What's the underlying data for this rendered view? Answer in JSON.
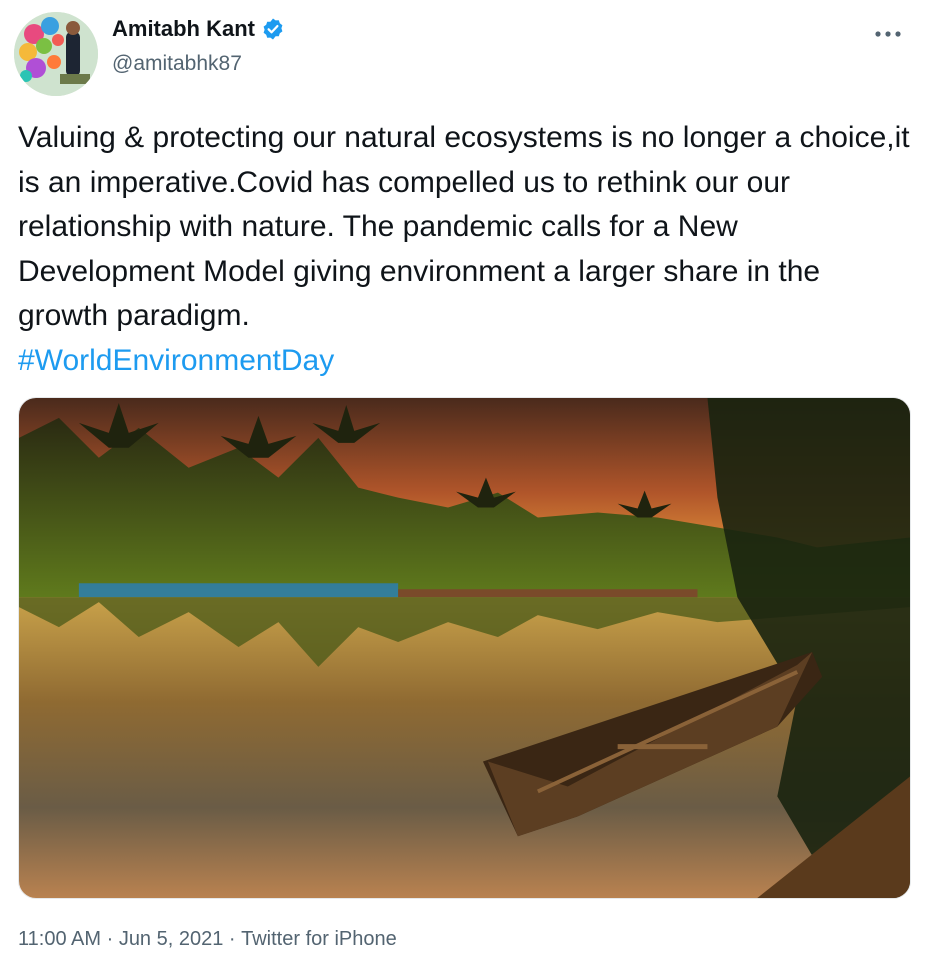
{
  "author": {
    "display_name": "Amitabh Kant",
    "handle": "@amitabhk87",
    "verified": true,
    "avatar_icon": "profile-photo"
  },
  "tweet": {
    "text": "Valuing & protecting our natural ecosystems is no longer a choice,it is an imperative.Covid has compelled us to rethink our our relationship with nature. The pandemic calls for a New Development Model giving environment a larger share in the growth paradigm.",
    "hashtag": "#WorldEnvironmentDay"
  },
  "media": {
    "icon": "backwater-sunset-boat-photo"
  },
  "meta": {
    "time": "11:00 AM",
    "separator": " · ",
    "date": "Jun 5, 2021",
    "source": "Twitter for iPhone"
  },
  "colors": {
    "link": "#1d9bf0",
    "secondary_text": "#536471",
    "verified_badge": "#1d9bf0"
  }
}
